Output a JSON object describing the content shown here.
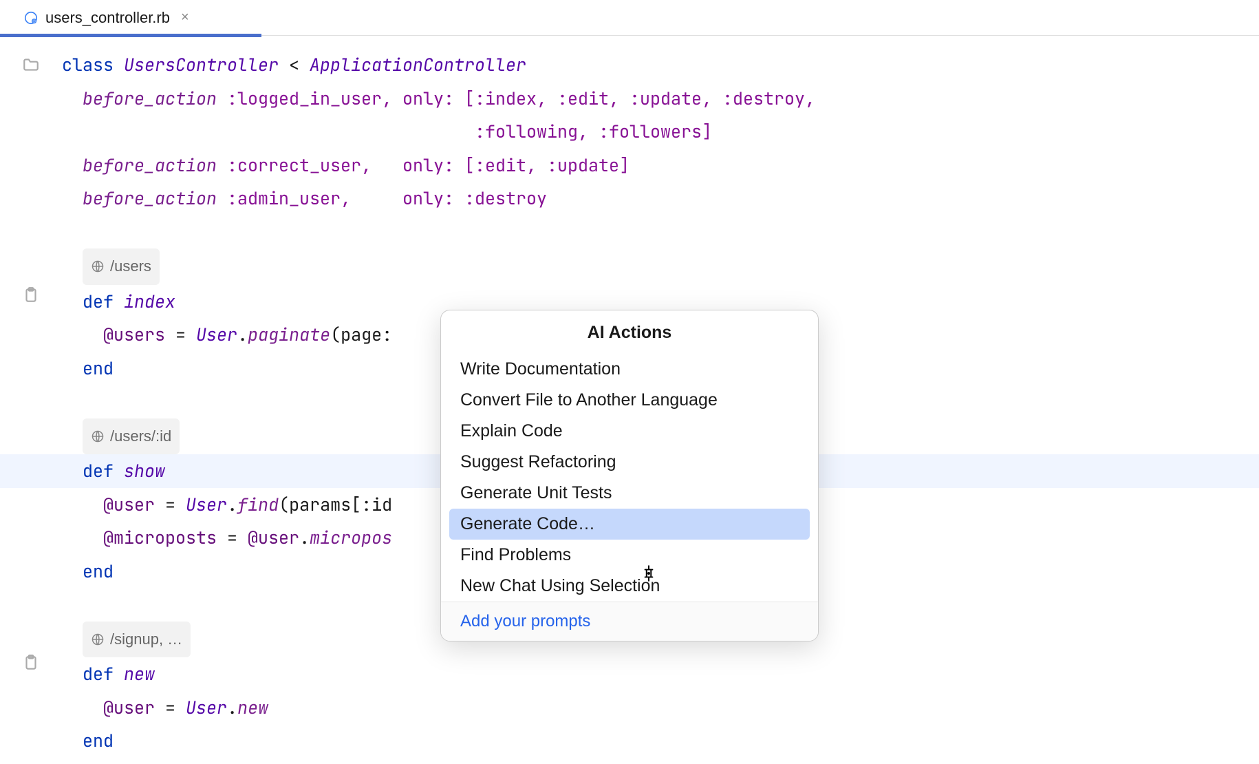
{
  "tab": {
    "filename": "users_controller.rb"
  },
  "hints": {
    "users": "/users",
    "users_id": "/users/:id",
    "signup": "/signup, …"
  },
  "code": {
    "l1_class": "class ",
    "l1_name": "UsersController",
    "l1_lt": " < ",
    "l1_parent": "ApplicationController",
    "l2_ba": "before_action",
    "l2_rest": " :logged_in_user, only: [:index, :edit, :update, :destroy,",
    "l3_rest": "                                        :following, :followers]",
    "l4_ba": "before_action",
    "l4_rest": " :correct_user,   only: [:edit, :update]",
    "l5_ba": "before_action",
    "l5_rest": " :admin_user,     only: :destroy",
    "l7_def": "def ",
    "l7_name": "index",
    "l8_ivar": "@users",
    "l8_eq": " = ",
    "l8_cls": "User",
    "l8_dot": ".",
    "l8_m": "paginate",
    "l8_rest": "(page:",
    "l9_end": "end",
    "l11_def": "def ",
    "l11_name": "show",
    "l12_ivar": "@user",
    "l12_eq": " = ",
    "l12_cls": "User",
    "l12_dot": ".",
    "l12_m": "find",
    "l12_rest": "(params[:id",
    "l13_ivar": "@microposts",
    "l13_eq": " = ",
    "l13_ivar2": "@user",
    "l13_dot": ".",
    "l13_m": "micropos",
    "l14_end": "end",
    "l16_def": "def ",
    "l16_name": "new",
    "l17_ivar": "@user",
    "l17_eq": " = ",
    "l17_cls": "User",
    "l17_dot": ".",
    "l17_m": "new",
    "l18_end": "end"
  },
  "popup": {
    "title": "AI Actions",
    "items": [
      "Write Documentation",
      "Convert File to Another Language",
      "Explain Code",
      "Suggest Refactoring",
      "Generate Unit Tests",
      "Generate Code…",
      "Find Problems",
      "New Chat Using Selection"
    ],
    "selected_index": 5,
    "footer": "Add your prompts"
  }
}
